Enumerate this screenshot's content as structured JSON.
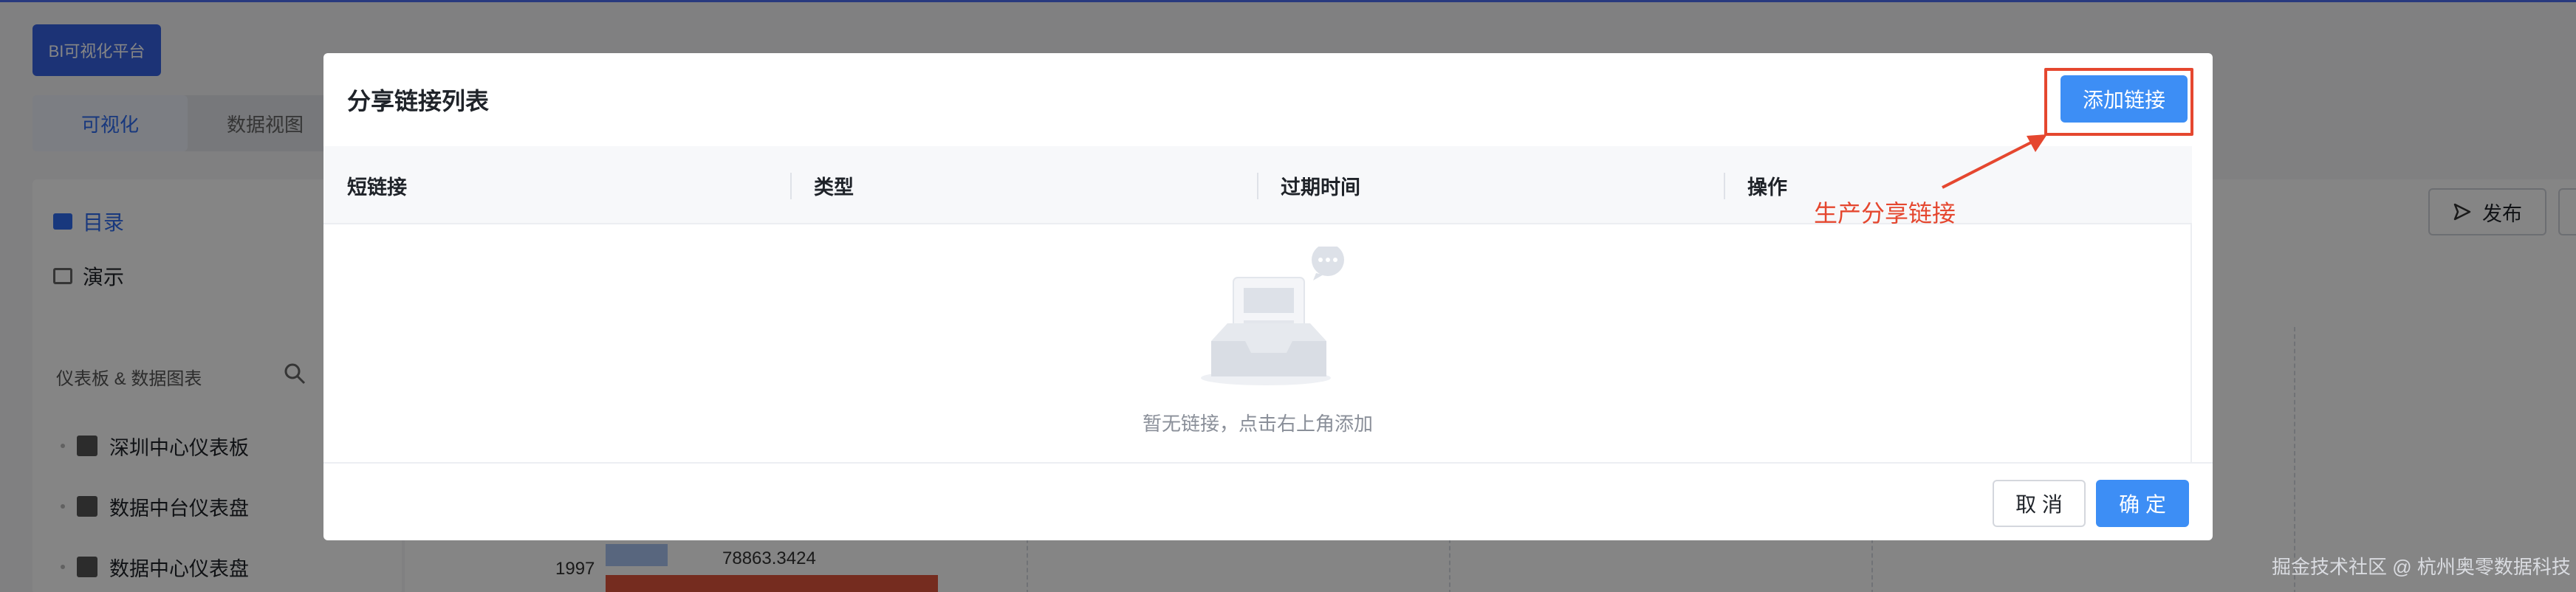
{
  "app": {
    "brand": "BI可视化平台",
    "tabs": [
      {
        "label": "可视化"
      },
      {
        "label": "数据视图"
      }
    ],
    "nav": {
      "directory": "目录",
      "demo": "演示"
    },
    "section_title": "仪表板 & 数据图表",
    "dashboards": [
      {
        "label": "深圳中心仪表板"
      },
      {
        "label": "数据中台仪表盘"
      },
      {
        "label": "数据中心仪表盘"
      }
    ],
    "publish_label": "发布",
    "chart": {
      "axis_label": "1997",
      "value_label": "78863.3424"
    }
  },
  "modal": {
    "title": "分享链接列表",
    "add_button": "添加链接",
    "columns": [
      {
        "label": "短链接"
      },
      {
        "label": "类型"
      },
      {
        "label": "过期时间"
      },
      {
        "label": "操作"
      }
    ],
    "empty_text": "暂无链接，点击右上角添加",
    "cancel_button": "取 消",
    "ok_button": "确 定"
  },
  "annotation": {
    "text": "生产分享链接",
    "color": "#e5472f"
  },
  "watermark": "掘金技术社区 @ 杭州奥零数据科技",
  "colors": {
    "primary": "#3d8ef5",
    "brand": "#3662e3",
    "accent": "#2f6bf0"
  }
}
